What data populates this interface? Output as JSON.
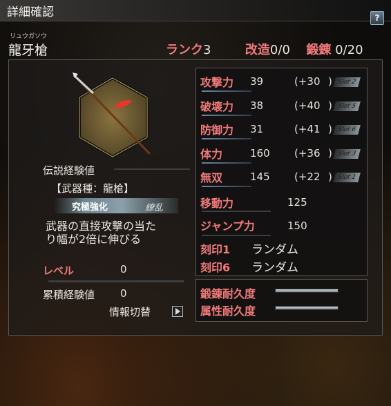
{
  "title": "詳細確認",
  "help_icon": "?",
  "weapon": {
    "ruby": "リュウガソウ",
    "name": "龍牙槍",
    "rank_label": "ランク",
    "rank_value": "3",
    "refine_label": "改造",
    "refine_value": "0/0",
    "forge_label": "鍛錬",
    "forge_value": "0/20"
  },
  "left": {
    "legend_exp_label": "伝説経験値",
    "legend_exp_progress": 0,
    "weapon_type": "【武器種：龍槍】",
    "ultimate_label": "究極強化",
    "ultimate_skill": "繚乱",
    "ultimate_desc_line1": "武器の直接攻撃の当た",
    "ultimate_desc_line2": "り幅が2倍に伸びる",
    "level_label": "レベル",
    "level_value": "0",
    "accum_exp_label": "累積経験値",
    "accum_exp_value": "0",
    "switch_label": "情報切替"
  },
  "stats": [
    {
      "label": "攻撃力",
      "value": "39",
      "bonus": "(+30",
      "slot": "Slot 2",
      "bar": 0.55
    },
    {
      "label": "破壊力",
      "value": "38",
      "bonus": "(+40",
      "slot": "Slot 5",
      "bar": 0.55
    },
    {
      "label": "防御力",
      "value": "31",
      "bonus": "(+41",
      "slot": "Slot 6",
      "bar": 0.55
    },
    {
      "label": "体力",
      "value": "160",
      "bonus": "(+36",
      "slot": "Slot 3",
      "bar": 0.55
    },
    {
      "label": "無双",
      "value": "145",
      "bonus": "(+22",
      "slot": "Slot 1",
      "bar": 0.55
    }
  ],
  "close_paren": ")",
  "move": {
    "label": "移動力",
    "value": "125"
  },
  "jump": {
    "label": "ジャンプ力",
    "value": "150"
  },
  "seals": [
    {
      "label": "刻印1",
      "value": "ランダム"
    },
    {
      "label": "刻印6",
      "value": "ランダム"
    }
  ],
  "durability": [
    {
      "label": "鍛錬耐久度",
      "fill": 1.0
    },
    {
      "label": "属性耐久度",
      "fill": 1.0
    }
  ]
}
